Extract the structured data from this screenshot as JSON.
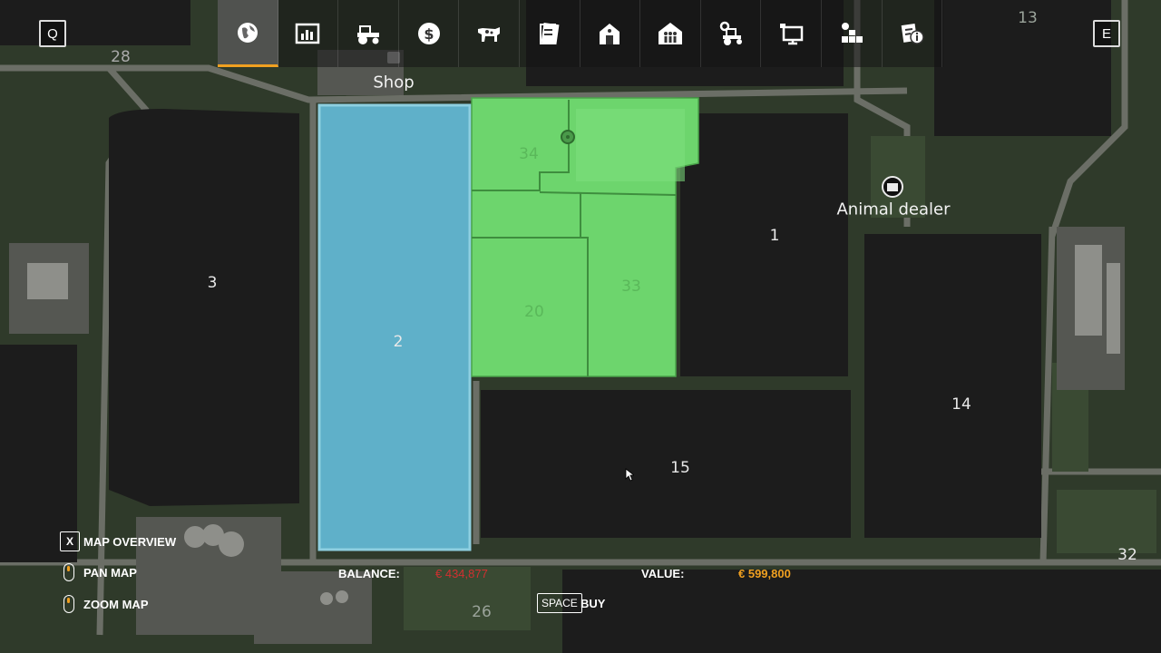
{
  "keys": {
    "prev": "Q",
    "next": "E"
  },
  "menu_tabs": [
    {
      "icon": "globe-icon",
      "active": true
    },
    {
      "icon": "statistics-icon"
    },
    {
      "icon": "tractor-icon"
    },
    {
      "icon": "finances-icon"
    },
    {
      "icon": "animals-icon"
    },
    {
      "icon": "contracts-icon"
    },
    {
      "icon": "barn-icon"
    },
    {
      "icon": "workers-icon"
    },
    {
      "icon": "vehicle-settings-icon"
    },
    {
      "icon": "display-icon"
    },
    {
      "icon": "production-icon"
    },
    {
      "icon": "help-info-icon"
    }
  ],
  "fields": {
    "f1": "1",
    "f2": "2",
    "f3": "3",
    "f14": "14",
    "f15": "15",
    "f20": "20",
    "f33": "33",
    "f34": "34",
    "f13": "13",
    "f28": "28",
    "f26": "26",
    "f32": "32"
  },
  "pois": {
    "shop": "Shop",
    "animal_dealer": "Animal dealer"
  },
  "hints": {
    "map_overview_key": "X",
    "map_overview": "MAP OVERVIEW",
    "pan_map": "PAN MAP",
    "zoom_map": "ZOOM MAP",
    "buy_key": "SPACE",
    "buy": "BUY"
  },
  "footer": {
    "balance_label": "BALANCE:",
    "balance_value": "€ 434,877",
    "value_label": "VALUE:",
    "value_value": "€ 599,800"
  },
  "colors": {
    "selected_field": "#5fb0c9",
    "owned_field": "#6dd56d",
    "balance_negative": "#d03030",
    "value_orange": "#f0a020"
  }
}
